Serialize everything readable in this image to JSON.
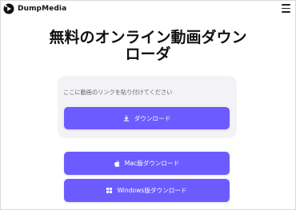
{
  "brand": {
    "name": "DumpMedia"
  },
  "header": {
    "menu_icon": "hamburger-menu-icon"
  },
  "hero": {
    "title_line1": "無料のオンライン動画ダウン",
    "title_line2": "ローダ"
  },
  "download_panel": {
    "url_placeholder": "ここに動画のリンクを貼り付けてください",
    "download_label": "ダウンロード",
    "download_icon": "download-arrow-icon"
  },
  "desktop": {
    "mac_label": "Mac版ダウンロード",
    "mac_icon": "apple-icon",
    "windows_label": "Windows版ダウンロード",
    "windows_icon": "windows-icon"
  },
  "colors": {
    "accent": "#6c5cff",
    "panel_bg": "#f3f3f7"
  }
}
